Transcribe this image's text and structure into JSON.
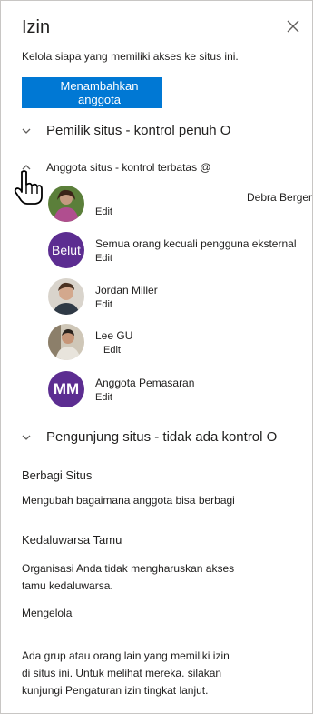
{
  "panel": {
    "title": "Izin",
    "subtitle": "Kelola siapa yang memiliki akses ke situs ini.",
    "add_button": "Menambahkan anggota"
  },
  "sections": {
    "owners": "Pemilik situs - kontrol penuh O",
    "members": "Anggota situs - kontrol terbatas @",
    "visitors": "Pengunjung situs - tidak ada kontrol O"
  },
  "members": [
    {
      "name": "Debra Berger",
      "role": "Edit"
    },
    {
      "name": "Semua orang kecuali pengguna eksternal",
      "role": "Edit",
      "avatar_text": "Belut"
    },
    {
      "name": "Jordan Miller",
      "role": "Edit"
    },
    {
      "name": "Lee GU",
      "role": "Edit"
    },
    {
      "name": "Anggota Pemasaran",
      "role": "Edit",
      "avatar_text": "MM"
    }
  ],
  "sharing": {
    "heading": "Berbagi Situs",
    "link": "Mengubah bagaimana anggota bisa berbagi"
  },
  "guest": {
    "heading": "Kedaluwarsa Tamu",
    "line1": "Organisasi Anda tidak mengharuskan akses",
    "line2": "tamu kedaluwarsa."
  },
  "manage": {
    "heading": "Mengelola",
    "line1": "Ada grup atau orang lain yang memiliki izin",
    "line2": "di situs ini. Untuk melihat mereka. silakan",
    "line3": "kunjungi Pengaturan izin tingkat lanjut."
  },
  "colors": {
    "accent": "#0078d4",
    "avatar_purple": "#5c2d91"
  },
  "icons": [
    "close-icon",
    "chevron-down-icon",
    "chevron-up-icon",
    "hand-cursor-icon"
  ]
}
